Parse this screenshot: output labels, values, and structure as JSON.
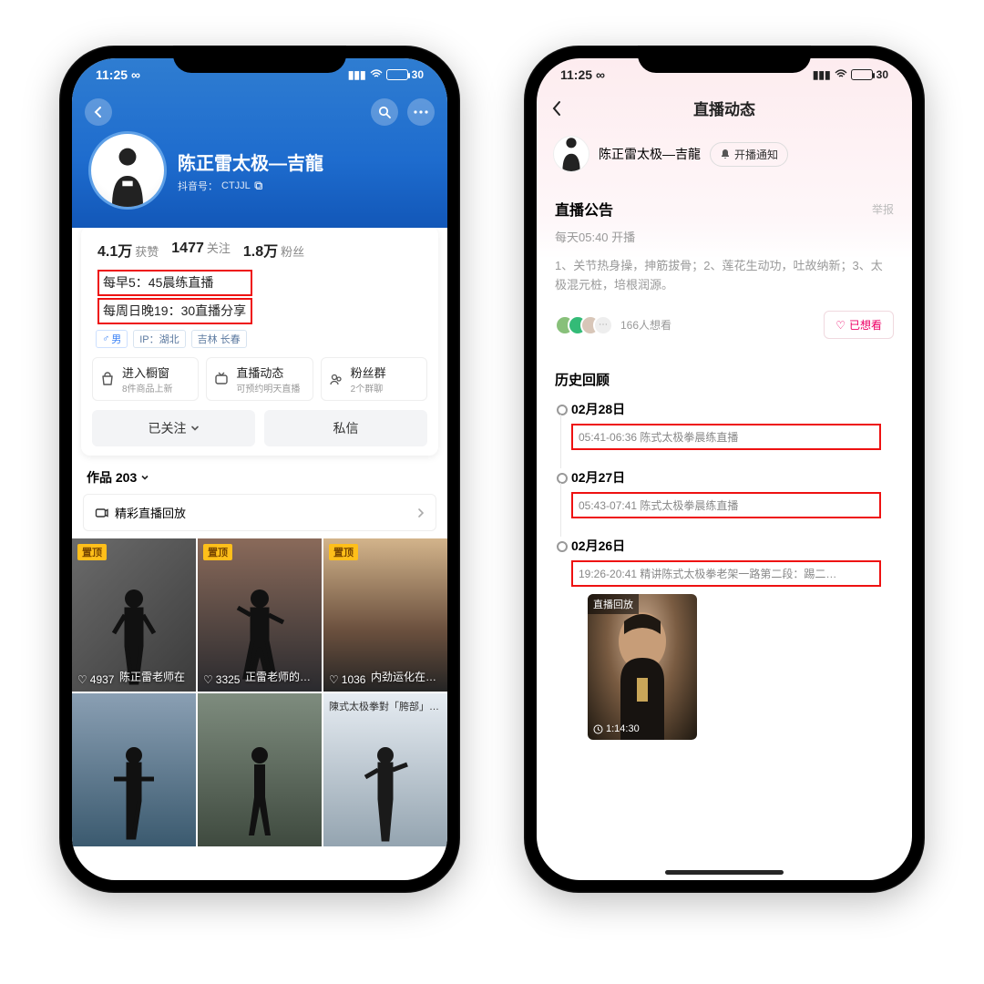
{
  "status": {
    "time": "11:25",
    "battery": "30"
  },
  "left": {
    "name": "陈正雷太极—吉龍",
    "id_label": "抖音号：",
    "id_value": "CTJJL",
    "stats": {
      "likes_num": "4.1万",
      "likes_label": "获赞",
      "follow_num": "1477",
      "follow_label": "关注",
      "fans_num": "1.8万",
      "fans_label": "粉丝"
    },
    "bio1": "每早5：45晨练直播",
    "bio2": "每周日晚19：30直播分享",
    "tags": {
      "gender": "男",
      "ip": "IP：湖北",
      "loc": "吉林 长春"
    },
    "actions": {
      "a1_title": "进入橱窗",
      "a1_sub": "8件商品上新",
      "a2_title": "直播动态",
      "a2_sub": "可预约明天直播",
      "a3_title": "粉丝群",
      "a3_sub": "2个群聊"
    },
    "buttons": {
      "followed": "已关注",
      "dm": "私信"
    },
    "works_label": "作品 203",
    "replay_label": "精彩直播回放",
    "pin": "置顶",
    "tiles": {
      "l1": "4937",
      "l2": "3325",
      "l3": "1036",
      "c1": "陈正雷老师在",
      "c2": "正雷老师的综合",
      "c3": "内劲运化在胸腰，折叠在脊",
      "c6": "陳式太极拳對「胯部」的要求"
    }
  },
  "right": {
    "title": "直播动态",
    "author": "陈正雷太极—吉龍",
    "notify": "开播通知",
    "notice_title": "直播公告",
    "report": "举报",
    "notice_time": "每天05:40 开播",
    "notice_body": "1、关节热身操，抻筋拔骨；2、莲花生动功，吐故纳新；3、太极混元桩，培根润源。",
    "want": "166人想看",
    "seen": "已想看",
    "history_title": "历史回顾",
    "entries": [
      {
        "date": "02月28日",
        "line": "05:41-06:36 陈式太极拳晨练直播"
      },
      {
        "date": "02月27日",
        "line": "05:43-07:41 陈式太极拳晨练直播"
      },
      {
        "date": "02月26日",
        "line": "19:26-20:41 精讲陈式太极拳老架一路第二段：踢二…"
      }
    ],
    "replay_tag": "直播回放",
    "replay_duration": "1:14:30"
  }
}
